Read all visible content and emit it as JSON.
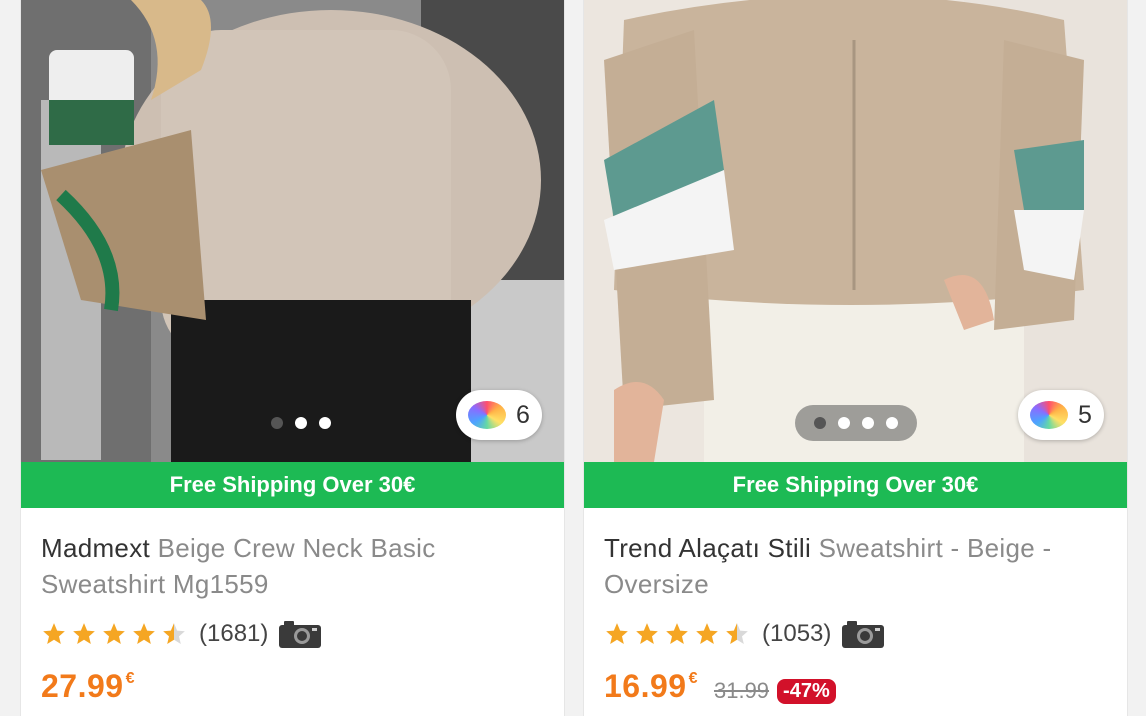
{
  "products": [
    {
      "brand": "Madmext",
      "name": "Beige Crew Neck Basic Sweatshirt Mg1559",
      "shipping_banner": "Free Shipping Over 30€",
      "image_count": 3,
      "active_image": 1,
      "variant_count": "6",
      "rating": 4.5,
      "review_count": "(1681)",
      "price": "27.99",
      "currency": "€",
      "image_icon": "product-photo"
    },
    {
      "brand": "Trend Alaçatı Stili",
      "name": "Sweatshirt - Beige - Oversize",
      "shipping_banner": "Free Shipping Over 30€",
      "image_count": 4,
      "active_image": 0,
      "variant_count": "5",
      "rating": 4.5,
      "review_count": "(1053)",
      "price": "16.99",
      "currency": "€",
      "old_price": "31.99",
      "discount": "-47%",
      "image_icon": "product-photo"
    }
  ],
  "colors": {
    "price": "#f27a1a",
    "shipping_bar": "#1dba54",
    "star": "#f5a623",
    "discount_badge": "#d2112a"
  }
}
